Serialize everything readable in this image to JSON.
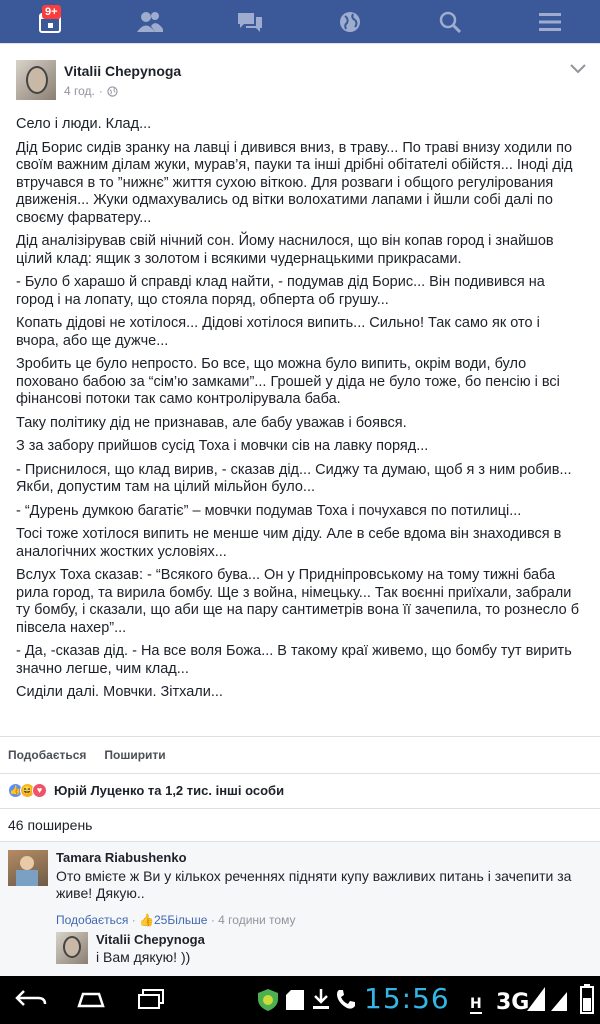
{
  "topbar": {
    "notification_badge": "9+",
    "icons": [
      "calendar-icon",
      "friends-icon",
      "messages-icon",
      "globe-icon",
      "search-icon",
      "menu-icon"
    ],
    "color": "#3b5998"
  },
  "post": {
    "author": "Vitalii Chepynoga",
    "time": "4 год.",
    "paragraphs": [
      "Село і люди. Клад...",
      "Дід Борис сидів зранку на лавці і дивився вниз, в траву... По траві внизу ходили по своїм важним ділам жуки, мурав’я, пауки та інші дрібні обітателі обійстя... Іноді дід втручався в то ”нижнє” життя сухою віткою. Для розваги і общого регулірования движенія... Жуки одмахувались од вітки волохатими лапами і йшли собі далі по своєму фарватеру...",
      "Дід аналізірував свій нічний сон. Йому наснилося, що він копав город і знайшов цілий клад: ящик з золотом і всякими чудернацькими прикрасами.",
      "- Було б харашо й справді клад найти, - подумав дід Борис... Він подивився на город і на лопату, що стояла поряд, обперта об грушу...",
      "Копать дідові не хотілося... Дідові хотілося випить... Сильно! Так само як ото і вчора, або ще дужче...",
      "Зробить це було непросто. Бо все, що можна було випить, окрім води, було поховано бабою за “сім’ю замками”... Грошей у діда не було тоже, бо пенсію і всі фінансові потоки так само контролірувала баба.",
      "Таку політику дід не признавав, але бабу уважав і боявся.",
      "З за забору прийшов сусід Тоха і мовчки сів на лавку поряд...",
      "- Приснилося, що клад вирив, - сказав дід... Сиджу та думаю, щоб я з ним робив... Якби, допустим там на цілий мільйон було...",
      "- “Дурень думкою багатіє” – мовчки подумав Тоха і почухався по потилиці...",
      "Тосі тоже хотілося випить не менше чим діду. Але в себе вдома він знаходився в аналогічних жостких условіях...",
      "Вслух Тоха сказав: - “Всякого бува... Он у Придніпровському на тому тижні баба рила город, та вирила бомбу. Ще з война, німецьку... Так воєнні приїхали, забрали ту бомбу, і сказали, що аби ще на пару сантиметрів вона її зачепила, то рознесло б півсела нахер”...",
      "- Да, -сказав дід. - На все воля Божа... В такому краї живемо, що бомбу тут вирить значно легше, чим клад...",
      "Сиділи далі. Мовчки. Зітхали..."
    ],
    "actions": {
      "like": "Подобається",
      "share": "Поширити"
    },
    "reactions_text": "Юрій Луценко та 1,2 тис. інші особи",
    "shares_text": "46 поширень"
  },
  "comments": [
    {
      "author": "Tamara Riabushenko",
      "text": "Ото вмієте ж Ви у кількох реченнях підняти купу важливих питань і зачепити за живе! Дякую..",
      "like": "Подобається",
      "likes_count": "25",
      "more": "Більше",
      "time": "4 години тому"
    }
  ],
  "reply": {
    "author": "Vitalii Chepynoga",
    "text": "і Вам дякую! ))"
  },
  "statusbar": {
    "time": "15:56",
    "network": "3G",
    "h_indicator": "H"
  }
}
